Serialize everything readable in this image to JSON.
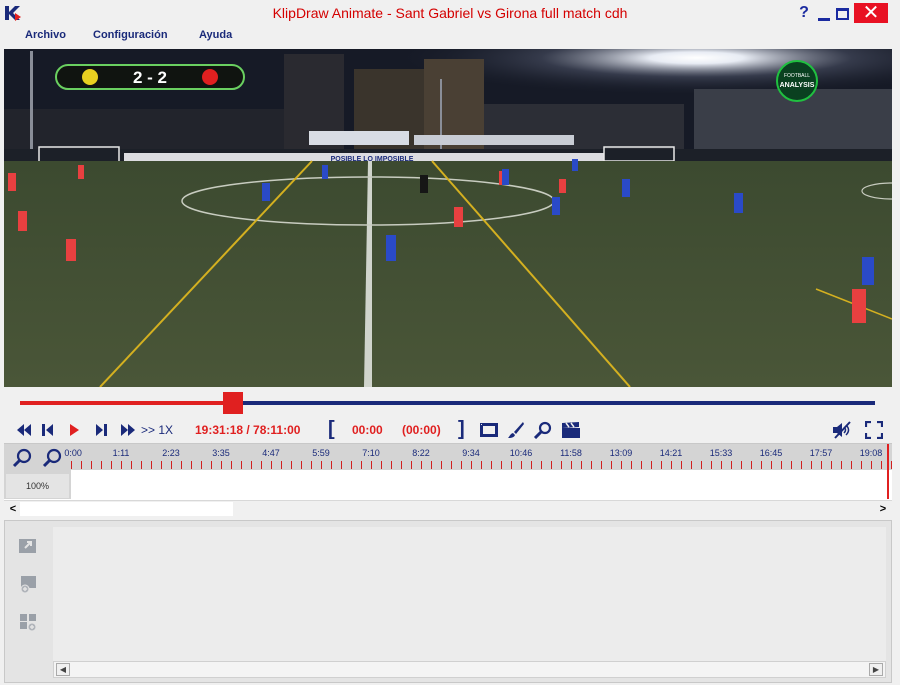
{
  "window": {
    "title": "KlipDraw Animate - Sant Gabriel vs Girona full match cdh",
    "help_label": "?",
    "close_label": "✕"
  },
  "menu": [
    "Archivo",
    "Configuración",
    "Ayuda"
  ],
  "video": {
    "score": "2 - 2",
    "badge_line1": "FOOTBALL",
    "badge_line2": "ANALYSIS",
    "banner_text": "POSIBLE LO IMPOSIBLE"
  },
  "playback": {
    "progress": 0.2495,
    "speed_label": ">> 1X",
    "timecode": "19:31:18 / 78:11:00",
    "mark_in": "00:00",
    "mark_duration": "(00:00)"
  },
  "timeline": {
    "zoom_percent": "100%",
    "ruler_labels": [
      "0:00",
      "1:11",
      "2:23",
      "3:35",
      "4:47",
      "5:59",
      "7:10",
      "8:22",
      "9:34",
      "10:46",
      "11:58",
      "13:09",
      "14:21",
      "15:33",
      "16:45",
      "17:57",
      "19:08"
    ]
  },
  "colors": {
    "accent_red": "#e02020",
    "accent_blue": "#1a2a7a",
    "title_red": "#d40000"
  },
  "icons": {
    "rewind": "rewind-icon",
    "step_back": "step-back-icon",
    "play": "play-icon",
    "step_forward": "step-forward-icon",
    "fast_forward": "fast-forward-icon",
    "fit_frame": "film-frame-icon",
    "draw": "paintbrush-icon",
    "zoom_video": "magnifier-icon",
    "clapper": "clapperboard-icon",
    "mute": "mute-icon",
    "fullscreen": "fullscreen-icon"
  }
}
